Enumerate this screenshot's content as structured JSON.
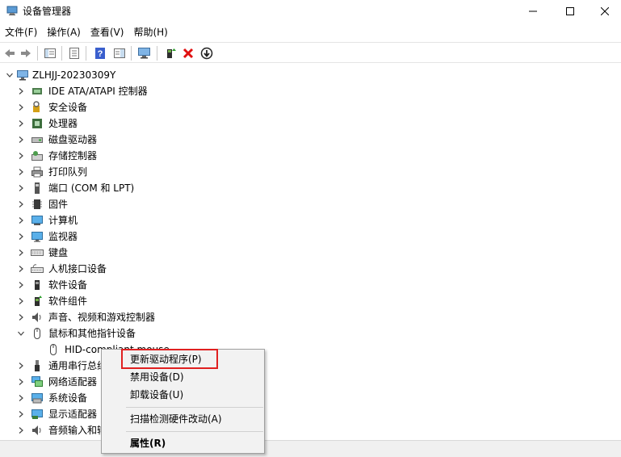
{
  "window": {
    "title": "设备管理器",
    "minimize_label": "—",
    "maximize_label": "☐",
    "close_label": "✕"
  },
  "menu": [
    {
      "label": "文件(F)"
    },
    {
      "label": "操作(A)"
    },
    {
      "label": "查看(V)"
    },
    {
      "label": "帮助(H)"
    }
  ],
  "toolbar": [
    {
      "icon": "back-arrow-icon"
    },
    {
      "icon": "forward-arrow-icon"
    },
    {
      "icon": "show-hide-console-tree-icon"
    },
    {
      "icon": "properties-icon"
    },
    {
      "icon": "help-icon"
    },
    {
      "icon": "action-pane-icon"
    },
    {
      "icon": "scan-hardware-icon"
    },
    {
      "icon": "update-driver-icon"
    },
    {
      "icon": "uninstall-device-icon"
    },
    {
      "icon": "disable-device-icon"
    }
  ],
  "tree": {
    "root": "ZLHJJ-20230309Y",
    "categories": [
      {
        "label": "IDE ATA/ATAPI 控制器",
        "icon": "ide-controller-icon"
      },
      {
        "label": "安全设备",
        "icon": "security-device-icon"
      },
      {
        "label": "处理器",
        "icon": "processor-icon"
      },
      {
        "label": "磁盘驱动器",
        "icon": "disk-drive-icon"
      },
      {
        "label": "存储控制器",
        "icon": "storage-controller-icon"
      },
      {
        "label": "打印队列",
        "icon": "printer-icon"
      },
      {
        "label": "端口 (COM 和 LPT)",
        "icon": "port-icon"
      },
      {
        "label": "固件",
        "icon": "firmware-icon"
      },
      {
        "label": "计算机",
        "icon": "computer-icon"
      },
      {
        "label": "监视器",
        "icon": "monitor-icon"
      },
      {
        "label": "键盘",
        "icon": "keyboard-icon"
      },
      {
        "label": "人机接口设备",
        "icon": "hid-icon"
      },
      {
        "label": "软件设备",
        "icon": "software-device-icon"
      },
      {
        "label": "软件组件",
        "icon": "software-component-icon"
      },
      {
        "label": "声音、视频和游戏控制器",
        "icon": "sound-icon"
      },
      {
        "label": "鼠标和其他指针设备",
        "icon": "mouse-icon",
        "expanded": true
      },
      {
        "label": "HID-compliant mouse",
        "icon": "mouse-icon",
        "child": true
      },
      {
        "label": "通用串行总线控制器",
        "icon": "usb-icon"
      },
      {
        "label": "网络适配器",
        "icon": "network-adapter-icon"
      },
      {
        "label": "系统设备",
        "icon": "system-device-icon"
      },
      {
        "label": "显示适配器",
        "icon": "display-adapter-icon"
      },
      {
        "label": "音频输入和输出",
        "icon": "audio-io-icon"
      }
    ]
  },
  "context_menu": {
    "items": [
      {
        "label": "更新驱动程序(P)"
      },
      {
        "label": "禁用设备(D)"
      },
      {
        "label": "卸载设备(U)"
      },
      {
        "label": "扫描检测硬件改动(A)"
      },
      {
        "label": "属性(R)"
      }
    ]
  },
  "colors": {
    "highlight_border": "#e02020",
    "menu_background": "#f2f2f2"
  }
}
